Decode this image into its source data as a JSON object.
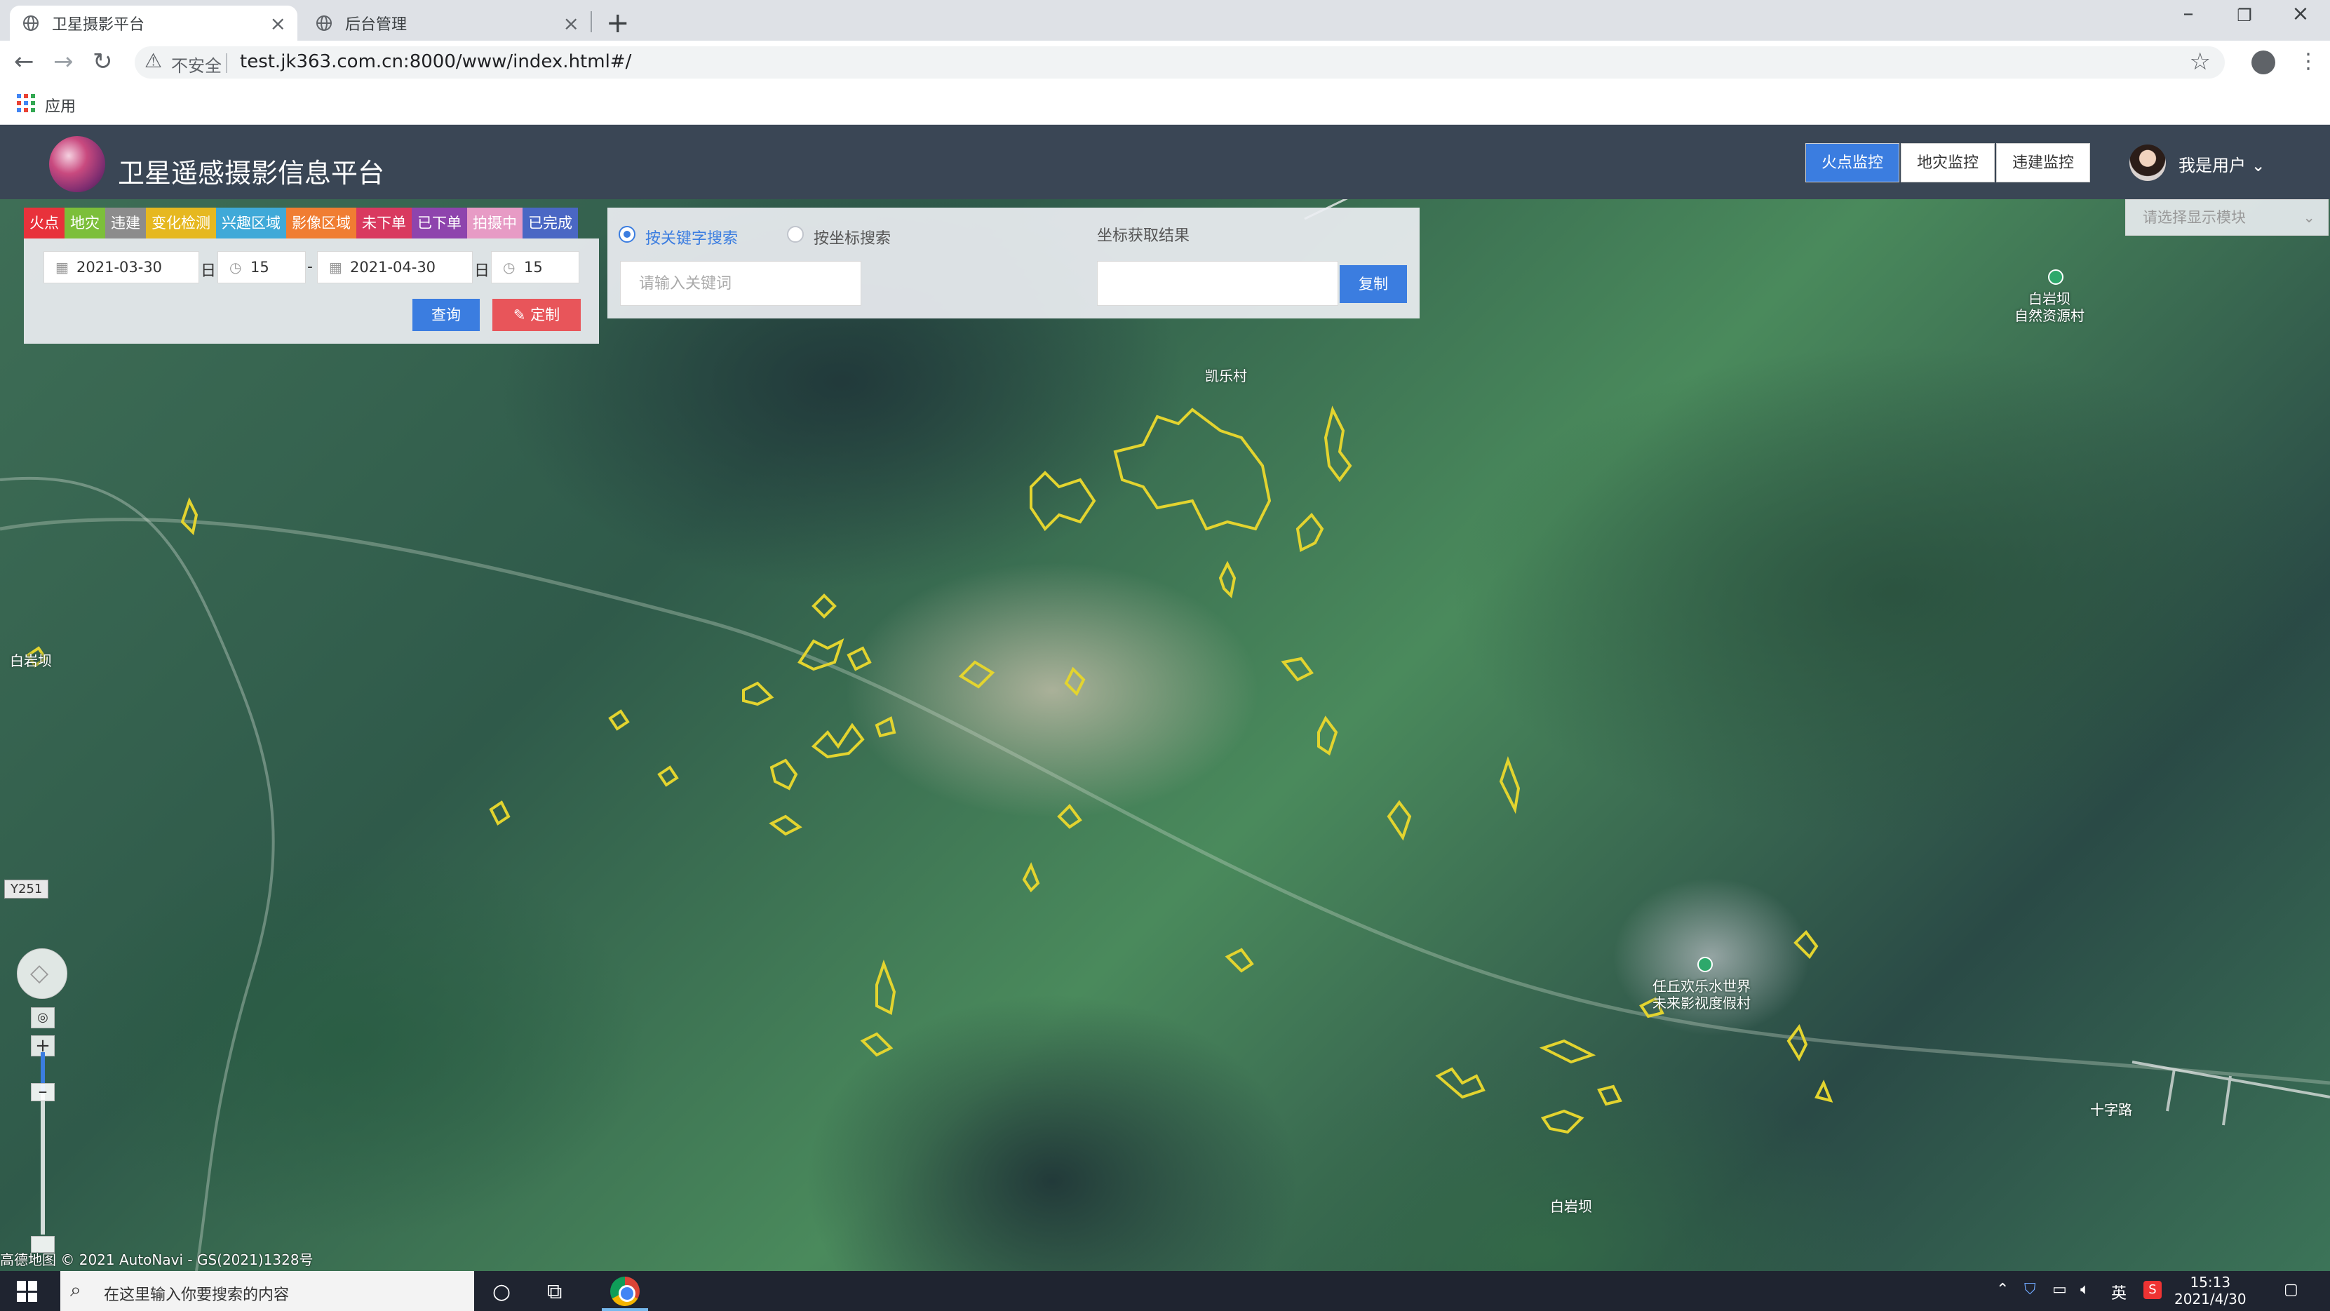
{
  "browser": {
    "tabs": [
      {
        "title": "卫星摄影平台",
        "active": true
      },
      {
        "title": "后台管理",
        "active": false
      }
    ],
    "insecure_label": "不安全",
    "url": "test.jk363.com.cn:8000/www/index.html#/",
    "bookmarks_apps": "应用"
  },
  "header": {
    "title": "卫星遥感摄影信息平台",
    "nav": [
      {
        "label": "火点监控",
        "active": true
      },
      {
        "label": "地灾监控",
        "active": false
      },
      {
        "label": "违建监控",
        "active": false
      }
    ],
    "user": "我是用户"
  },
  "filters": {
    "categories": [
      {
        "label": "火点",
        "color": "#e8323b"
      },
      {
        "label": "地灾",
        "color": "#7cbf3a"
      },
      {
        "label": "违建",
        "color": "#8c8c8c"
      },
      {
        "label": "变化检测",
        "color": "#e6b820"
      },
      {
        "label": "兴趣区域",
        "color": "#3fa9d8"
      },
      {
        "label": "影像区域",
        "color": "#f07d32"
      },
      {
        "label": "未下单",
        "color": "#d9395f"
      },
      {
        "label": "已下单",
        "color": "#8e44ad"
      },
      {
        "label": "拍摄中",
        "color": "#e79bc5"
      },
      {
        "label": "已完成",
        "color": "#4a67c4"
      }
    ],
    "start_date": "2021-03-30",
    "start_day_unit": "日",
    "start_hour": "15",
    "range_sep": "-",
    "end_date": "2021-04-30",
    "end_day_unit": "日",
    "end_hour": "15",
    "query_label": "查询",
    "custom_label": "定制"
  },
  "search": {
    "keyword_radio": "按关键字搜索",
    "coord_radio": "按坐标搜索",
    "keyword_placeholder": "请输入关键词",
    "coord_result_label": "坐标获取结果",
    "coord_value": "",
    "copy_label": "复制"
  },
  "module_select": {
    "placeholder": "请选择显示模块"
  },
  "map": {
    "labels": [
      {
        "text": "凯乐村",
        "name": "village-label-1"
      },
      {
        "text": "白岩坝",
        "name": "village-label-2"
      },
      {
        "text": "白岩坝",
        "name": "village-label-3"
      },
      {
        "text": "白岩坝\n自然资源村",
        "name": "poi-label-1"
      },
      {
        "text": "任丘欢乐水世界\n未来影视度假村",
        "name": "poi-label-2"
      },
      {
        "text": "十字路",
        "name": "road-label"
      }
    ],
    "road_badge": "Y251",
    "attribution": "高德地图 © 2021 AutoNavi - GS(2021)1328号"
  },
  "taskbar": {
    "search_text": "在这里输入你要搜索的内容",
    "ime": "英",
    "time": "15:13",
    "date": "2021/4/30"
  }
}
